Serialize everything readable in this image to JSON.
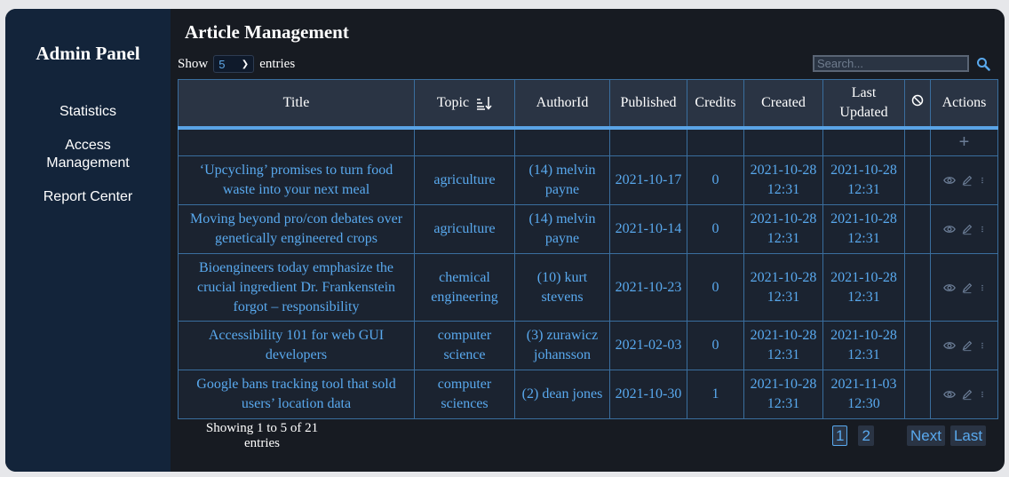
{
  "sidebar": {
    "brand": "Admin Panel",
    "items": [
      {
        "label": "Statistics"
      },
      {
        "label": "Access Management"
      },
      {
        "label": "Report Center"
      }
    ]
  },
  "header": {
    "title": "Article Management",
    "show_label": "Show",
    "entries_label": "entries",
    "page_size": "5",
    "search_placeholder": "Search..."
  },
  "table": {
    "columns": [
      "Title",
      "Topic",
      "AuthorId",
      "Published",
      "Credits",
      "Created",
      "Last Updated",
      "",
      "Actions"
    ],
    "sort_column": "Topic",
    "rows": [
      {
        "title": "‘Upcycling’ promises to turn food waste into your next meal",
        "topic": "agriculture",
        "author": "(14) melvin payne",
        "published": "2021-10-17",
        "credits": "0",
        "created": "2021-10-28 12:31",
        "updated": "2021-10-28 12:31"
      },
      {
        "title": "Moving beyond pro/con debates over genetically engineered crops",
        "topic": "agriculture",
        "author": "(14) melvin payne",
        "published": "2021-10-14",
        "credits": "0",
        "created": "2021-10-28 12:31",
        "updated": "2021-10-28 12:31"
      },
      {
        "title": "Bioengineers today emphasize the crucial ingredient Dr. Frankenstein forgot – responsibility",
        "topic": "chemical engineering",
        "author": "(10) kurt stevens",
        "published": "2021-10-23",
        "credits": "0",
        "created": "2021-10-28 12:31",
        "updated": "2021-10-28 12:31"
      },
      {
        "title": "Accessibility 101 for web GUI developers",
        "topic": "computer science",
        "author": "(3) zurawicz johansson",
        "published": "2021-02-03",
        "credits": "0",
        "created": "2021-10-28 12:31",
        "updated": "2021-10-28 12:31"
      },
      {
        "title": "Google bans tracking tool that sold users’ location data",
        "topic": "computer sciences",
        "author": "(2) dean jones",
        "published": "2021-10-30",
        "credits": "1",
        "created": "2021-10-28 12:31",
        "updated": "2021-11-03 12:30"
      }
    ]
  },
  "footer": {
    "info": "Showing 1 to 5 of 21 entries",
    "pages": [
      "1",
      "2"
    ],
    "current_page": "1",
    "next_label": "Next",
    "last_label": "Last"
  },
  "colors": {
    "accent": "#59a9ee",
    "sidebar": "#13243a",
    "background": "#171b22"
  }
}
